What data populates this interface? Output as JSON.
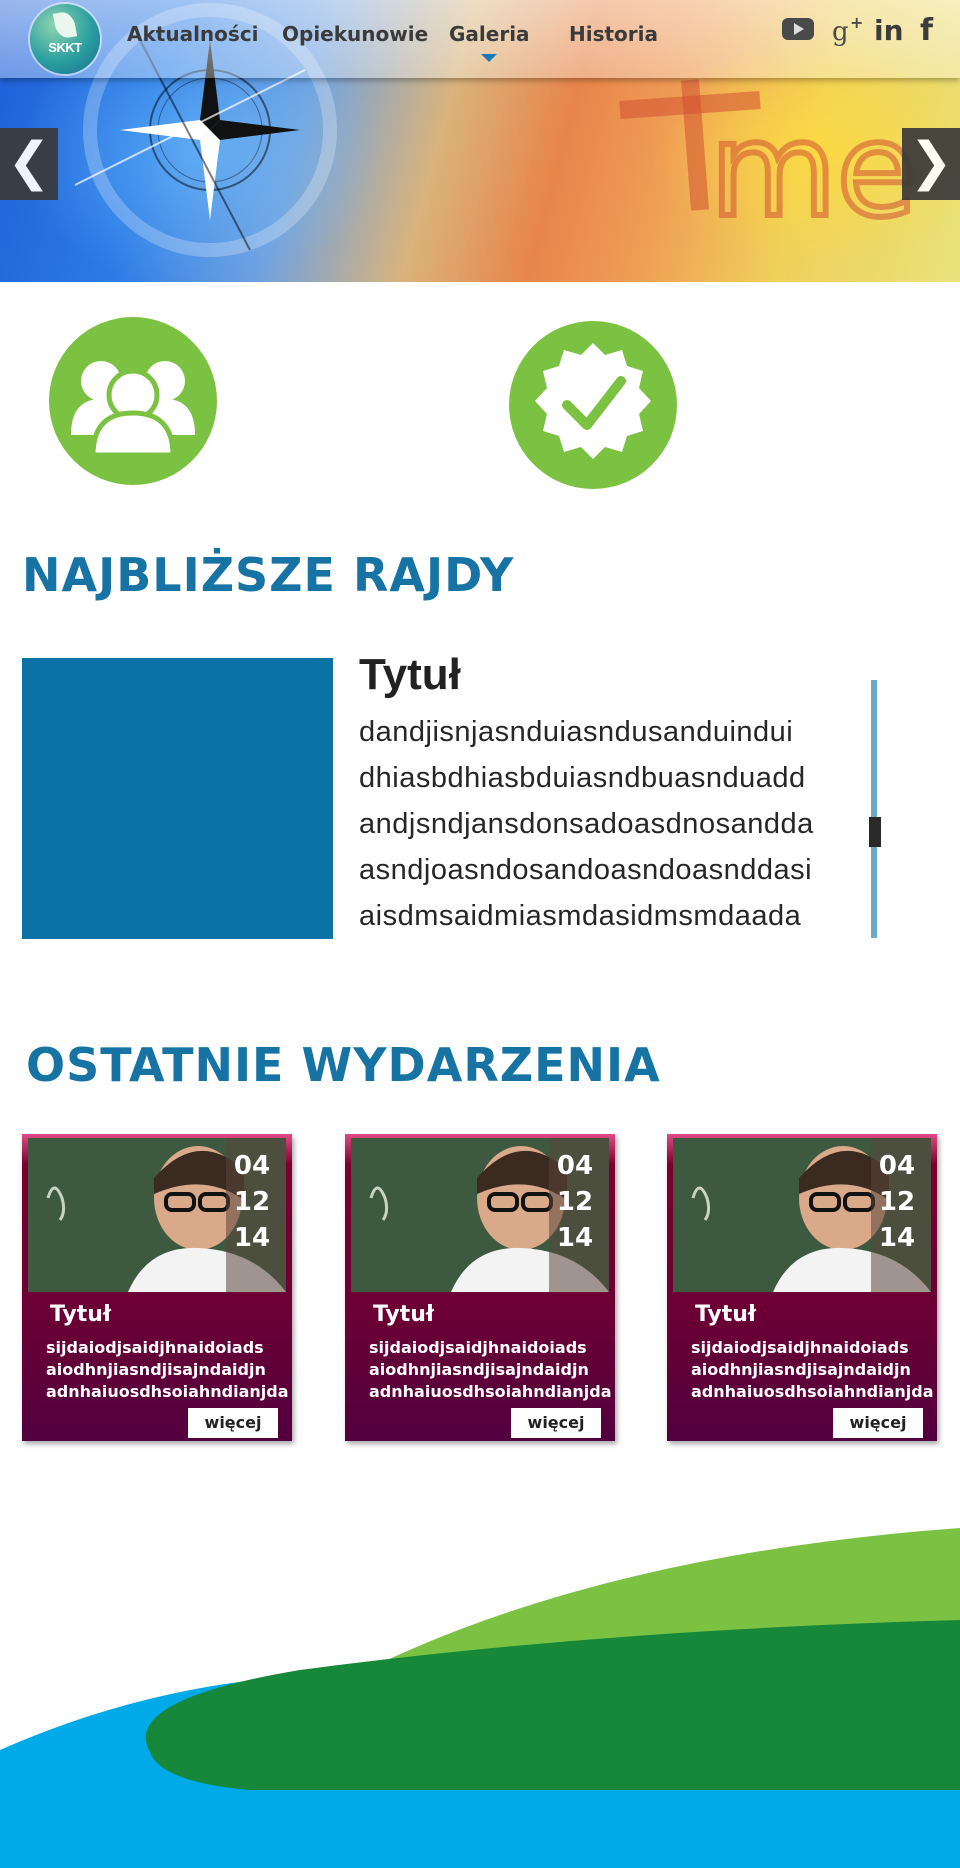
{
  "nav": {
    "items": [
      {
        "label": "Aktualności"
      },
      {
        "label": "Opiekunowie"
      },
      {
        "label": "Galeria",
        "active": true
      },
      {
        "label": "Historia"
      }
    ]
  },
  "logo": {
    "text": "SKKT"
  },
  "social": [
    "youtube-icon",
    "google-plus-icon",
    "linkedin-icon",
    "facebook-icon"
  ],
  "slider": {
    "prev_label": "❮",
    "next_label": "❯"
  },
  "features": [
    "users-icon",
    "badge-check-icon"
  ],
  "colors": {
    "accent_blue": "#1673a3",
    "green": "#7cc242",
    "dark_green": "#17873a",
    "card_maroon": "#6a0035",
    "sky_blue": "#00a9e8"
  },
  "upcoming": {
    "heading": "NAJBLIŻSZE RAJDY",
    "title": "Tytuł",
    "lines": [
      "dandjisnjasnduiasndusanduindui",
      "dhiasbdhiasbduiasndbuasnduadd",
      "andjsndjansdonsadoasdnosandda",
      "asndjoasndosandoasndoasnddasi",
      "aisdmsaidmiasmdasidmsmdaada"
    ]
  },
  "recent": {
    "heading": "OSTATNIE WYDARZENIA",
    "cards": [
      {
        "date": [
          "04",
          "12",
          "14"
        ],
        "title": "Tytuł",
        "lines": [
          "sijdaiodjsaidjhnaidoiads",
          "aiodhnjiasndjisajndaidjn",
          "adnhaiuosdhsoiahndianjda"
        ],
        "more": "więcej"
      },
      {
        "date": [
          "04",
          "12",
          "14"
        ],
        "title": "Tytuł",
        "lines": [
          "sijdaiodjsaidjhnaidoiads",
          "aiodhnjiasndjisajndaidjn",
          "adnhaiuosdhsoiahndianjda"
        ],
        "more": "więcej"
      },
      {
        "date": [
          "04",
          "12",
          "14"
        ],
        "title": "Tytuł",
        "lines": [
          "sijdaiodjsaidjhnaidoiads",
          "aiodhnjiasndjisajndaidjn",
          "adnhaiuosdhsoiahndianjda"
        ],
        "more": "więcej"
      }
    ]
  }
}
